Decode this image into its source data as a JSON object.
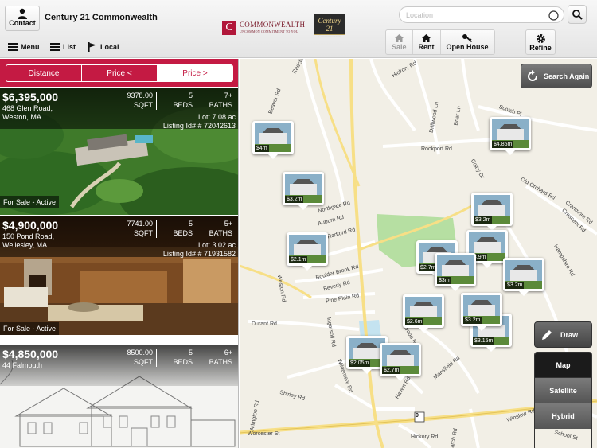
{
  "header": {
    "contact_label": "Contact",
    "office_name": "Century 21 Commonwealth",
    "menu_label": "Menu",
    "list_label": "List",
    "local_label": "Local",
    "logo_mark": "C",
    "logo_name": "COMMONWEALTH",
    "logo_tagline": "UNCOMMON COMMITMENT TO YOU",
    "c21_logo_top": "Century 21",
    "c21_logo_bottom": "Commonwealth",
    "location_placeholder": "Location",
    "modes": [
      {
        "label": "Sale",
        "icon": "house-icon",
        "enabled": false
      },
      {
        "label": "Rent",
        "icon": "house-icon",
        "enabled": true
      },
      {
        "label": "Open House",
        "icon": "key-icon",
        "enabled": true
      }
    ],
    "refine_label": "Refine"
  },
  "sort": {
    "items": [
      "Distance",
      "Price <",
      "Price >"
    ],
    "active": "Price >"
  },
  "listings": [
    {
      "price": "$6,395,000",
      "address": "468 Glen Road,",
      "city": "Weston, MA",
      "sqft": "9378.00",
      "sqft_label": "SQFT",
      "beds": "5",
      "beds_label": "BEDS",
      "baths": "7+",
      "baths_label": "BATHS",
      "lot": "Lot: 7.08 ac",
      "listing_id": "Listing Id# # 72042613",
      "status": "For Sale - Active"
    },
    {
      "price": "$4,900,000",
      "address": "150 Pond Road,",
      "city": "Wellesley, MA",
      "sqft": "7741.00",
      "sqft_label": "SQFT",
      "beds": "5",
      "beds_label": "BEDS",
      "baths": "5+",
      "baths_label": "BATHS",
      "lot": "Lot: 3.02 ac",
      "listing_id": "Listing Id# # 71931582",
      "status": "For Sale - Active"
    },
    {
      "price": "$4,850,000",
      "address": "44 Falmouth",
      "city": "",
      "sqft": "8500.00",
      "sqft_label": "SQFT",
      "beds": "5",
      "beds_label": "BEDS",
      "baths": "6+",
      "baths_label": "BATHS",
      "lot": "",
      "listing_id": "",
      "status": ""
    }
  ],
  "map": {
    "search_again_label": "Search Again",
    "draw_label": "Draw",
    "map_types": [
      "Map",
      "Satellite",
      "Hybrid"
    ],
    "active_map_type": "Map",
    "route_shield": "9",
    "pins": [
      "$4m",
      "$3.2m",
      "$4.85m",
      "$3.2m",
      "$2.1m",
      "$2.7m",
      "$3m",
      "$3.2m",
      "$2.6m",
      "$3.15m",
      "$2.05m",
      "$2.7m",
      "$3.2m",
      "$3.9m"
    ],
    "roads": [
      "Radcliff Rd",
      "Hickory Rd",
      "Scotch Pi",
      "Beaver Rd",
      "Briar Ln",
      "Driftwood Ln",
      "Rockport Rd",
      "Colby Dr",
      "Old Orchard Rd",
      "Crescent Rd",
      "Northgate Rd",
      "Auburn Rd",
      "Radford Rd",
      "Weston Rd",
      "Boulder Brook Rd",
      "Beverly Rd",
      "Pine Plain Rd",
      "Durant Rd",
      "Ingersoll Rd",
      "Wood Rd",
      "Haven Rd",
      "Wildemere Rd",
      "Shirley Rd",
      "Worcester St",
      "Mansfield Rd",
      "Hampshire Rd",
      "Cranmore Rd",
      "School St",
      "Hickory Rd",
      "Winslow Rd",
      "Larch Rd",
      "Arlington Rd"
    ]
  }
}
